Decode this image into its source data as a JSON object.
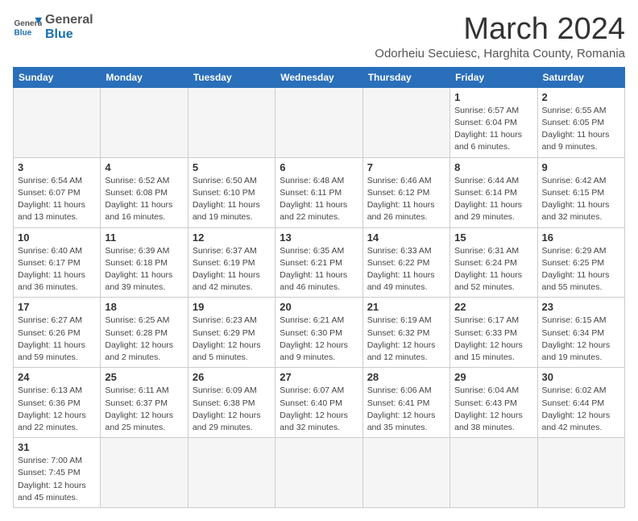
{
  "header": {
    "logo_general": "General",
    "logo_blue": "Blue",
    "month_title": "March 2024",
    "location": "Odorheiu Secuiesc, Harghita County, Romania"
  },
  "weekdays": [
    "Sunday",
    "Monday",
    "Tuesday",
    "Wednesday",
    "Thursday",
    "Friday",
    "Saturday"
  ],
  "weeks": [
    [
      {
        "day": "",
        "info": ""
      },
      {
        "day": "",
        "info": ""
      },
      {
        "day": "",
        "info": ""
      },
      {
        "day": "",
        "info": ""
      },
      {
        "day": "",
        "info": ""
      },
      {
        "day": "1",
        "info": "Sunrise: 6:57 AM\nSunset: 6:04 PM\nDaylight: 11 hours and 6 minutes."
      },
      {
        "day": "2",
        "info": "Sunrise: 6:55 AM\nSunset: 6:05 PM\nDaylight: 11 hours and 9 minutes."
      }
    ],
    [
      {
        "day": "3",
        "info": "Sunrise: 6:54 AM\nSunset: 6:07 PM\nDaylight: 11 hours and 13 minutes."
      },
      {
        "day": "4",
        "info": "Sunrise: 6:52 AM\nSunset: 6:08 PM\nDaylight: 11 hours and 16 minutes."
      },
      {
        "day": "5",
        "info": "Sunrise: 6:50 AM\nSunset: 6:10 PM\nDaylight: 11 hours and 19 minutes."
      },
      {
        "day": "6",
        "info": "Sunrise: 6:48 AM\nSunset: 6:11 PM\nDaylight: 11 hours and 22 minutes."
      },
      {
        "day": "7",
        "info": "Sunrise: 6:46 AM\nSunset: 6:12 PM\nDaylight: 11 hours and 26 minutes."
      },
      {
        "day": "8",
        "info": "Sunrise: 6:44 AM\nSunset: 6:14 PM\nDaylight: 11 hours and 29 minutes."
      },
      {
        "day": "9",
        "info": "Sunrise: 6:42 AM\nSunset: 6:15 PM\nDaylight: 11 hours and 32 minutes."
      }
    ],
    [
      {
        "day": "10",
        "info": "Sunrise: 6:40 AM\nSunset: 6:17 PM\nDaylight: 11 hours and 36 minutes."
      },
      {
        "day": "11",
        "info": "Sunrise: 6:39 AM\nSunset: 6:18 PM\nDaylight: 11 hours and 39 minutes."
      },
      {
        "day": "12",
        "info": "Sunrise: 6:37 AM\nSunset: 6:19 PM\nDaylight: 11 hours and 42 minutes."
      },
      {
        "day": "13",
        "info": "Sunrise: 6:35 AM\nSunset: 6:21 PM\nDaylight: 11 hours and 46 minutes."
      },
      {
        "day": "14",
        "info": "Sunrise: 6:33 AM\nSunset: 6:22 PM\nDaylight: 11 hours and 49 minutes."
      },
      {
        "day": "15",
        "info": "Sunrise: 6:31 AM\nSunset: 6:24 PM\nDaylight: 11 hours and 52 minutes."
      },
      {
        "day": "16",
        "info": "Sunrise: 6:29 AM\nSunset: 6:25 PM\nDaylight: 11 hours and 55 minutes."
      }
    ],
    [
      {
        "day": "17",
        "info": "Sunrise: 6:27 AM\nSunset: 6:26 PM\nDaylight: 11 hours and 59 minutes."
      },
      {
        "day": "18",
        "info": "Sunrise: 6:25 AM\nSunset: 6:28 PM\nDaylight: 12 hours and 2 minutes."
      },
      {
        "day": "19",
        "info": "Sunrise: 6:23 AM\nSunset: 6:29 PM\nDaylight: 12 hours and 5 minutes."
      },
      {
        "day": "20",
        "info": "Sunrise: 6:21 AM\nSunset: 6:30 PM\nDaylight: 12 hours and 9 minutes."
      },
      {
        "day": "21",
        "info": "Sunrise: 6:19 AM\nSunset: 6:32 PM\nDaylight: 12 hours and 12 minutes."
      },
      {
        "day": "22",
        "info": "Sunrise: 6:17 AM\nSunset: 6:33 PM\nDaylight: 12 hours and 15 minutes."
      },
      {
        "day": "23",
        "info": "Sunrise: 6:15 AM\nSunset: 6:34 PM\nDaylight: 12 hours and 19 minutes."
      }
    ],
    [
      {
        "day": "24",
        "info": "Sunrise: 6:13 AM\nSunset: 6:36 PM\nDaylight: 12 hours and 22 minutes."
      },
      {
        "day": "25",
        "info": "Sunrise: 6:11 AM\nSunset: 6:37 PM\nDaylight: 12 hours and 25 minutes."
      },
      {
        "day": "26",
        "info": "Sunrise: 6:09 AM\nSunset: 6:38 PM\nDaylight: 12 hours and 29 minutes."
      },
      {
        "day": "27",
        "info": "Sunrise: 6:07 AM\nSunset: 6:40 PM\nDaylight: 12 hours and 32 minutes."
      },
      {
        "day": "28",
        "info": "Sunrise: 6:06 AM\nSunset: 6:41 PM\nDaylight: 12 hours and 35 minutes."
      },
      {
        "day": "29",
        "info": "Sunrise: 6:04 AM\nSunset: 6:43 PM\nDaylight: 12 hours and 38 minutes."
      },
      {
        "day": "30",
        "info": "Sunrise: 6:02 AM\nSunset: 6:44 PM\nDaylight: 12 hours and 42 minutes."
      }
    ],
    [
      {
        "day": "31",
        "info": "Sunrise: 7:00 AM\nSunset: 7:45 PM\nDaylight: 12 hours and 45 minutes."
      },
      {
        "day": "",
        "info": ""
      },
      {
        "day": "",
        "info": ""
      },
      {
        "day": "",
        "info": ""
      },
      {
        "day": "",
        "info": ""
      },
      {
        "day": "",
        "info": ""
      },
      {
        "day": "",
        "info": ""
      }
    ]
  ]
}
